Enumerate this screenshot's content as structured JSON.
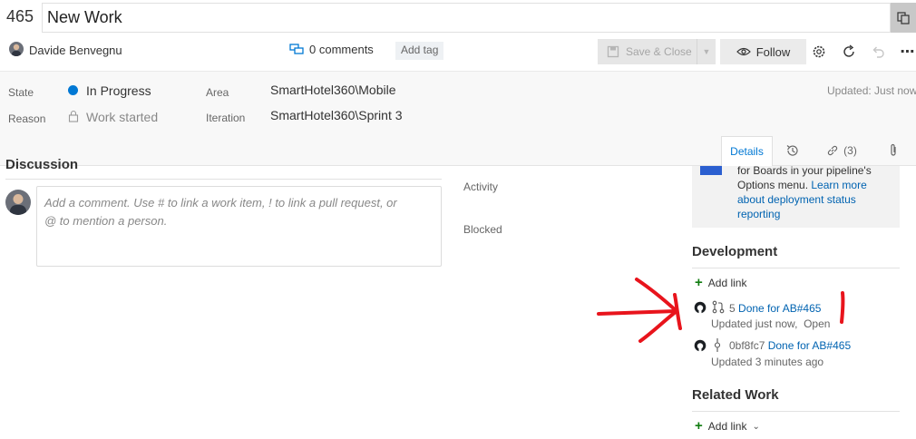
{
  "title_bar": {
    "work_id": "465",
    "title": "New Work"
  },
  "header": {
    "assignee": "Davide Benvegnu",
    "comments": "0 comments",
    "add_tag": "Add tag",
    "save_close": "Save & Close",
    "follow": "Follow"
  },
  "fields": {
    "state_label": "State",
    "state_value": "In Progress",
    "reason_label": "Reason",
    "reason_value": "Work started",
    "area_label": "Area",
    "area_value": "SmartHotel360\\Mobile",
    "iteration_label": "Iteration",
    "iteration_value": "SmartHotel360\\Sprint 3",
    "updated": "Updated: Just now"
  },
  "tabs": {
    "details": "Details",
    "links_count": "(3)"
  },
  "discussion": {
    "heading": "Discussion",
    "placeholder_line1": "Add a comment. Use # to link a work item, ! to link a pull request, or",
    "placeholder_line2": "@ to mention a person."
  },
  "planning": {
    "activity": "Activity",
    "blocked": "Blocked"
  },
  "info_box": {
    "line1": "for Boards in your pipeline's",
    "line2_text": "Options menu. ",
    "line2_link": "Learn more",
    "line3_link": "about deployment status",
    "line4_link": "reporting"
  },
  "development": {
    "heading": "Development",
    "add_link": "Add link",
    "items": [
      {
        "number": "5",
        "link": "Done for AB#465",
        "sub": "Updated just now,  Open"
      },
      {
        "number": "0bf8fc7",
        "link": "Done for AB#465",
        "sub": "Updated 3 minutes ago"
      }
    ]
  },
  "related_work": {
    "heading": "Related Work",
    "add_link": "Add link"
  },
  "colors": {
    "accent": "#0078d4",
    "annotation": "#e8141c",
    "plus": "#107c10"
  }
}
